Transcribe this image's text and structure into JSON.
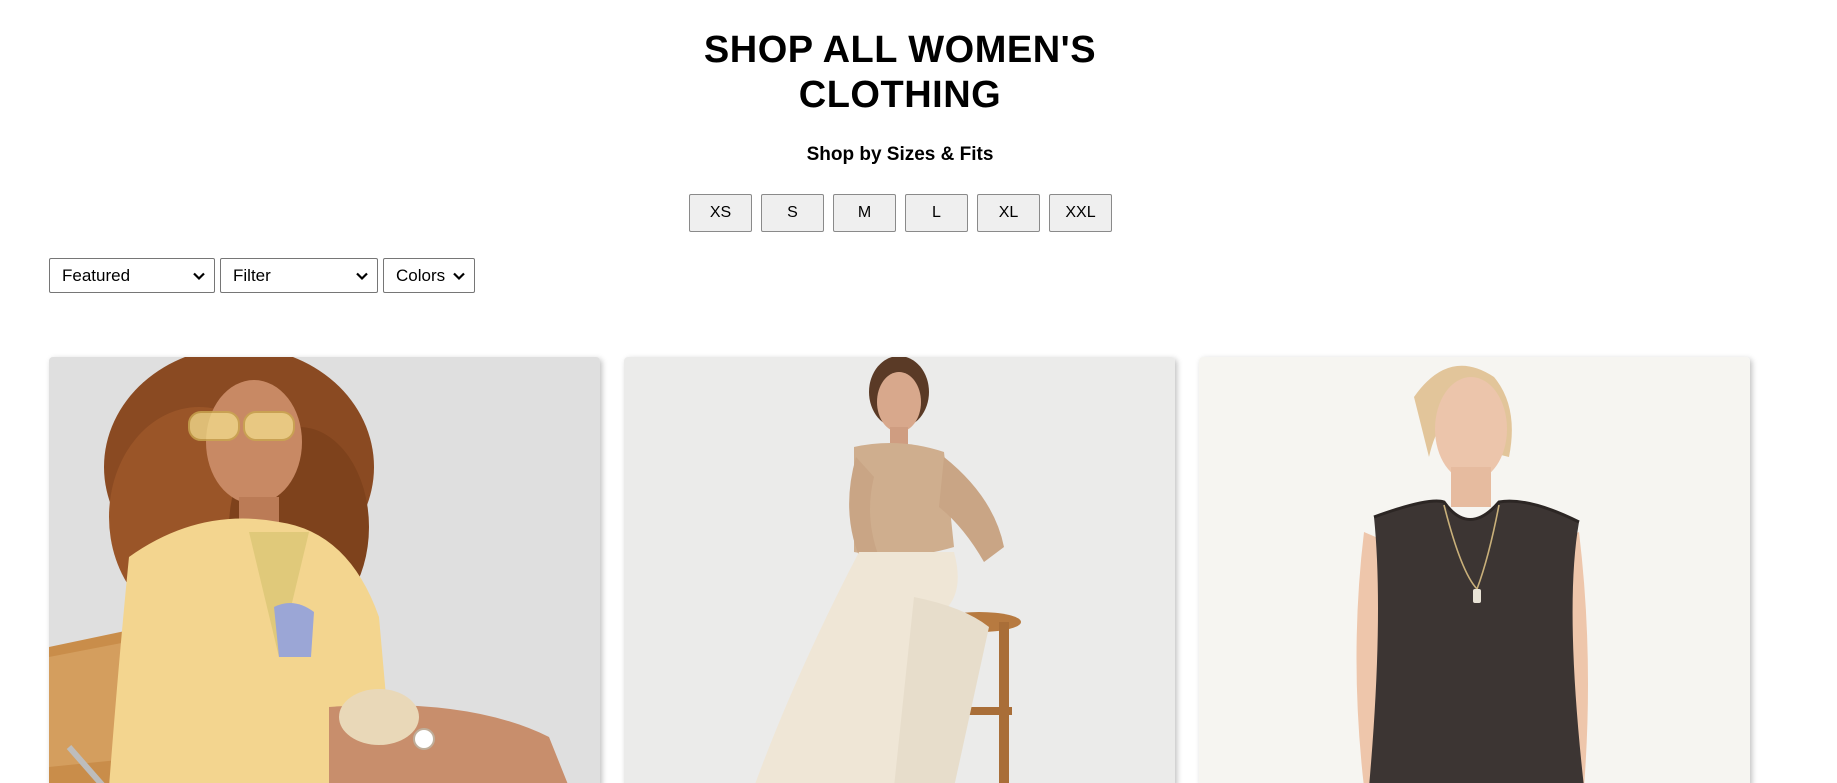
{
  "page": {
    "title": "SHOP ALL WOMEN'S CLOTHING"
  },
  "sizes": {
    "heading": "Shop by Sizes & Fits",
    "options": [
      "XS",
      "S",
      "M",
      "L",
      "XL",
      "XXL"
    ]
  },
  "controls": {
    "sort": {
      "selected": "Featured"
    },
    "filter": {
      "selected": "Filter"
    },
    "colors": {
      "selected": "Colors"
    }
  },
  "products": [
    {
      "image": "woman-in-yellow-linen-shirt-on-cane-chair",
      "background": "#e4e4e4"
    },
    {
      "image": "woman-in-beige-sweater-and-cream-pants-on-stool",
      "background": "#ebebea"
    },
    {
      "image": "woman-in-charcoal-sleeveless-tank",
      "background": "#f6f5f1"
    }
  ]
}
